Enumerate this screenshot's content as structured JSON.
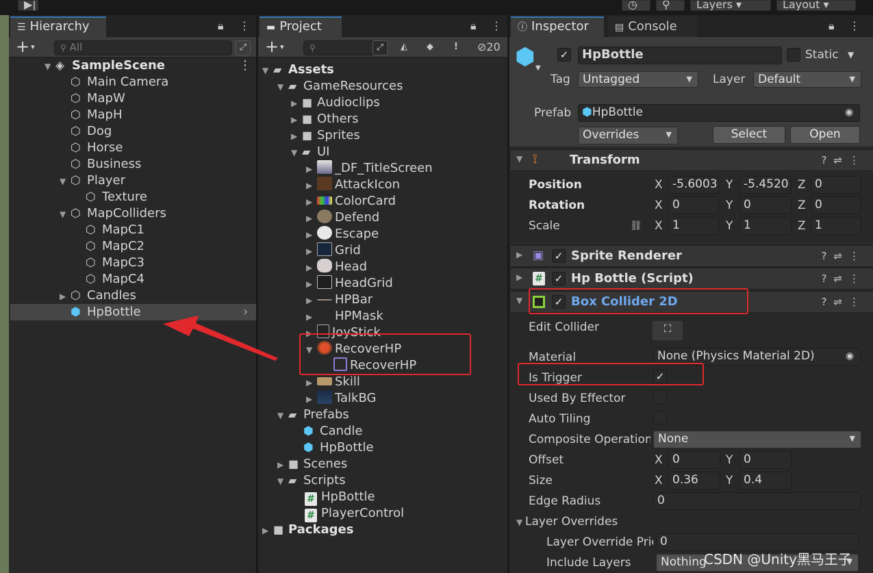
{
  "top": {
    "layers_label": "Layers",
    "layout_label": "Layout"
  },
  "hierarchy": {
    "tab_label": "Hierarchy",
    "search_placeholder": "All",
    "scene_name": "SampleScene",
    "items": [
      "Main Camera",
      "MapW",
      "MapH",
      "Dog",
      "Horse",
      "Business",
      "Player",
      "Texture",
      "MapColliders",
      "MapC1",
      "MapC2",
      "MapC3",
      "MapC4",
      "Candles",
      "HpBottle"
    ],
    "selected": "HpBottle"
  },
  "project": {
    "tab_label": "Project",
    "hidden_count": "20",
    "items": [
      "Assets",
      "GameResources",
      "Audioclips",
      "Others",
      "Sprites",
      "UI",
      "_DF_TitleScreen",
      "AttackIcon",
      "ColorCard",
      "Defend",
      "Escape",
      "Grid",
      "Head",
      "HeadGrid",
      "HPBar",
      "HPMask",
      "JoyStick",
      "RecoverHP",
      "RecoverHP",
      "Skill",
      "TalkBG",
      "Prefabs",
      "Candle",
      "HpBottle",
      "Scenes",
      "Scripts",
      "HpBottle",
      "PlayerControl",
      "Packages"
    ]
  },
  "inspector": {
    "tab_label": "Inspector",
    "console_tab_label": "Console",
    "object_name": "HpBottle",
    "static_label": "Static",
    "tag_label": "Tag",
    "tag_value": "Untagged",
    "layer_label": "Layer",
    "layer_value": "Default",
    "prefab_label": "Prefab",
    "prefab_value": "HpBottle",
    "overrides_label": "Overrides",
    "select_label": "Select",
    "open_label": "Open",
    "transform": {
      "title": "Transform",
      "position_label": "Position",
      "rotation_label": "Rotation",
      "scale_label": "Scale",
      "position": {
        "x": "-5.6003",
        "y": "-5.4520",
        "z": "0"
      },
      "rotation": {
        "x": "0",
        "y": "0",
        "z": "0"
      },
      "scale": {
        "x": "1",
        "y": "1",
        "z": "1"
      }
    },
    "sprite_renderer_title": "Sprite Renderer",
    "script_title": "Hp Bottle (Script)",
    "box_collider": {
      "title": "Box Collider 2D",
      "edit_collider_label": "Edit Collider",
      "material_label": "Material",
      "material_value": "None (Physics Material 2D)",
      "is_trigger_label": "Is Trigger",
      "is_trigger": true,
      "used_by_effector_label": "Used By Effector",
      "auto_tiling_label": "Auto Tiling",
      "composite_label": "Composite Operation",
      "composite_value": "None",
      "offset_label": "Offset",
      "offset": {
        "x": "0",
        "y": "0"
      },
      "size_label": "Size",
      "size": {
        "x": "0.36",
        "y": "0.4"
      },
      "edge_radius_label": "Edge Radius",
      "edge_radius_value": "0",
      "layer_overrides_label": "Layer Overrides",
      "layer_override_priority_label": "Layer Override Priority",
      "layer_override_priority_value": "0",
      "include_layers_label": "Include Layers",
      "include_layers_value": "Nothing"
    }
  },
  "watermark": "CSDN @Unity黑马王子",
  "colors": {
    "accent_blue": "#3a79bb",
    "annotation_red": "#e0282d",
    "prefab_blue": "#5cc6f5"
  }
}
